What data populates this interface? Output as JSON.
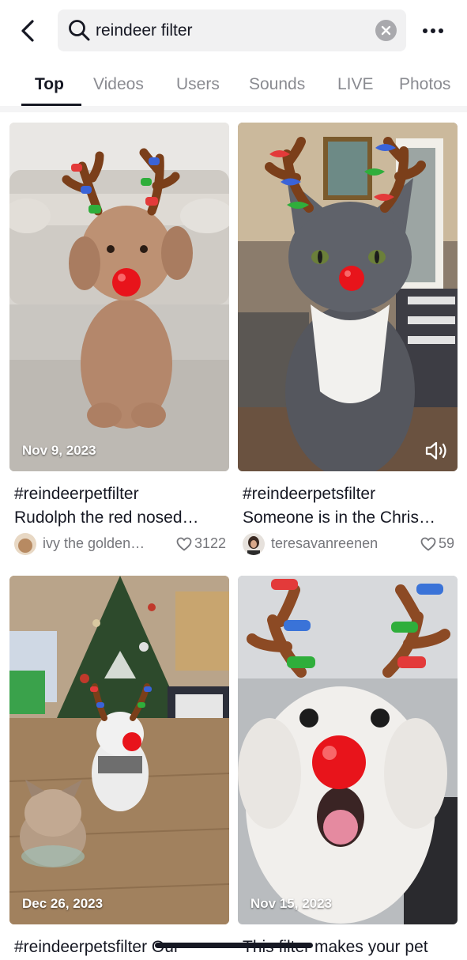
{
  "header": {
    "back_icon": "chevron-left-icon",
    "search_query": "reindeer filter",
    "search_icon": "search-icon",
    "clear_icon": "clear-icon",
    "more_icon": "more-horizontal-icon"
  },
  "tabs": [
    {
      "label": "Top",
      "active": true
    },
    {
      "label": "Videos",
      "active": false
    },
    {
      "label": "Users",
      "active": false
    },
    {
      "label": "Sounds",
      "active": false
    },
    {
      "label": "LIVE",
      "active": false
    },
    {
      "label": "Photos",
      "active": false
    }
  ],
  "results": [
    {
      "date": "Nov 9, 2023",
      "caption_line1": "#reindeerpetfilter",
      "caption_line2": "Rudolph the red nosed…",
      "author": "ivy the golden…",
      "likes": "3122"
    },
    {
      "date": "",
      "caption_line1": "#reindeerpetsfilter",
      "caption_line2": "Someone is in the Chris…",
      "author": "teresavanreenen",
      "likes": "59",
      "sound_icon": "speaker-icon"
    },
    {
      "date": "Dec 26, 2023",
      "caption_line1": "#reindeerpetsfilter Our",
      "caption_line2": ""
    },
    {
      "date": "Nov 15, 2023",
      "caption_line1": "This filter makes your pet",
      "caption_line2": ""
    }
  ],
  "colors": {
    "text_primary": "#161823",
    "text_secondary": "#8a8b91",
    "search_bg": "#f1f1f2",
    "nose_red": "#e8141b"
  }
}
